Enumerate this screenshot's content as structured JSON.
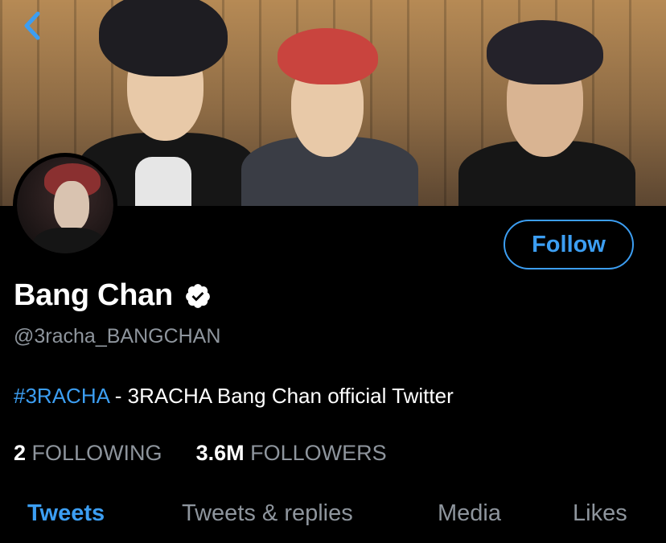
{
  "profile": {
    "display_name": "Bang Chan",
    "handle": "@3racha_BANGCHAN",
    "verified": true,
    "bio": {
      "hashtag": "#3RACHA",
      "text": " - 3RACHA Bang Chan official Twitter"
    }
  },
  "actions": {
    "follow_label": "Follow"
  },
  "stats": {
    "following_count": "2",
    "following_label": "FOLLOWING",
    "followers_count": "3.6M",
    "followers_label": "FOLLOWERS"
  },
  "tabs": [
    {
      "label": "Tweets",
      "active": true
    },
    {
      "label": "Tweets & replies",
      "active": false
    },
    {
      "label": "Media",
      "active": false
    },
    {
      "label": "Likes",
      "active": false
    }
  ],
  "icons": {
    "back": "chevron-left-icon",
    "verified": "verified-badge-icon"
  },
  "colors": {
    "accent": "#3c9ef2",
    "background": "#000000",
    "secondary_text": "#8e959d",
    "primary_text": "#ffffff"
  }
}
